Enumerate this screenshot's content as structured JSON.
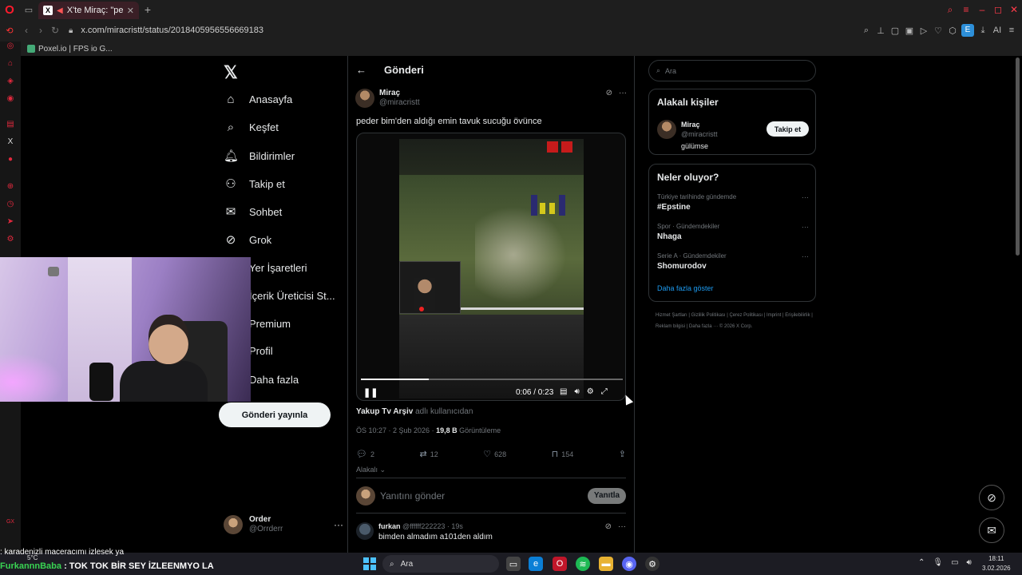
{
  "browser": {
    "tab_title": "X'te Miraç: \"peder bim'",
    "url": "x.com/miracristt/status/2018405956556669183",
    "bookmark": "Poxel.io | FPS io G..."
  },
  "nav": {
    "items": [
      "Anasayfa",
      "Keşfet",
      "Bildirimler",
      "Takip et",
      "Sohbet",
      "Grok",
      "Yer İşaretleri",
      "İçerik Üreticisi St...",
      "Premium",
      "Profil",
      "Daha fazla"
    ],
    "post_button": "Gönderi yayınla",
    "profile_name": "Order",
    "profile_handle": "@Orrderr"
  },
  "post": {
    "header": "Gönderi",
    "author_name": "Miraç",
    "author_handle": "@miracristt",
    "text": "peder bim'den aldığı emin tavuk sucuğu övünce",
    "video": {
      "time": "0:06 / 0:23",
      "progress": 0.26
    },
    "source_account": "Yakup Tv Arşiv",
    "source_suffix": "adlı kullanıcıdan",
    "timestamp": "ÖS 10:27 · 2 Şub 2026 · ",
    "views": "19,8 B",
    "views_label": " Görüntüleme",
    "stats": {
      "replies": "2",
      "reposts": "12",
      "likes": "628",
      "bookmarks": "154"
    },
    "related_label": "Alakalı",
    "reply_placeholder": "Yanıtını gönder",
    "reply_button": "Yanıtla"
  },
  "reply": {
    "name": "furkan",
    "handle": "@ffffff222223 · 19s",
    "text": "bimden almadım a101den aldım"
  },
  "right": {
    "search_placeholder": "Ara",
    "related_title": "Alakalı kişiler",
    "person_name": "Miraç",
    "person_handle": "@miracristt",
    "person_bio": "gülümse",
    "follow_label": "Takip et",
    "trends_title": "Neler oluyor?",
    "trends": [
      {
        "context": "Türkiye tarihinde gündemde",
        "topic": "#Epstine"
      },
      {
        "context": "Spor · Gündemdekiler",
        "topic": "Nhaga"
      },
      {
        "context": "Serie A · Gündemdekiler",
        "topic": "Shomurodov"
      }
    ],
    "show_more": "Daha fazla göster",
    "footer": "Hizmet Şartları  |  Gizlilik Politikası  |  Çerez Politikası  |  Imprint  |  Erişilebilirlik  |  Reklam bilgisi  |  Daha fazla ···  © 2026 X Corp."
  },
  "overlay": {
    "chat1_text": ": karadenizli maceracımı izlesek ya",
    "chat2_user": "FurkannnBaba",
    "chat2_text": " : TOK TOK BİR SEY İZLEENMYO LA"
  },
  "taskbar": {
    "weather": "5°C",
    "search": "Ara",
    "time": "18:11",
    "date": "3.02.2026"
  }
}
